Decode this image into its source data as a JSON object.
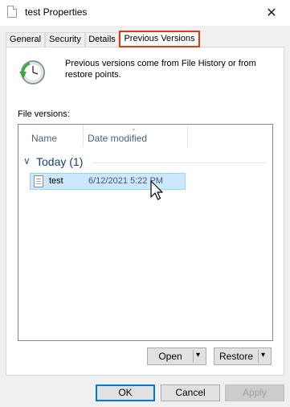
{
  "window": {
    "title": "test Properties",
    "close_glyph": "✕",
    "icon": "document-icon"
  },
  "tabs": [
    {
      "label": "General",
      "active": false
    },
    {
      "label": "Security",
      "active": false
    },
    {
      "label": "Details",
      "active": false
    },
    {
      "label": "Previous Versions",
      "active": true
    }
  ],
  "info": {
    "icon": "restore-clock-icon",
    "text": "Previous versions come from File History or from restore points."
  },
  "file_versions": {
    "label": "File versions:",
    "columns": [
      "Name",
      "Date modified"
    ],
    "sort_glyph": "⌄",
    "groups": [
      {
        "label": "Today (1)",
        "chevron": "∨",
        "items": [
          {
            "name": "test",
            "date_modified": "6/12/2021 5:22 PM",
            "selected": true
          }
        ]
      }
    ]
  },
  "actions": {
    "open_label": "Open",
    "restore_label": "Restore",
    "dropdown_glyph": "▾"
  },
  "footer": {
    "ok_label": "OK",
    "cancel_label": "Cancel",
    "apply_label": "Apply"
  },
  "colors": {
    "active_tab_outline": "#e0381a",
    "selection_bg": "#cce8ff",
    "default_button_border": "#0078d7"
  }
}
